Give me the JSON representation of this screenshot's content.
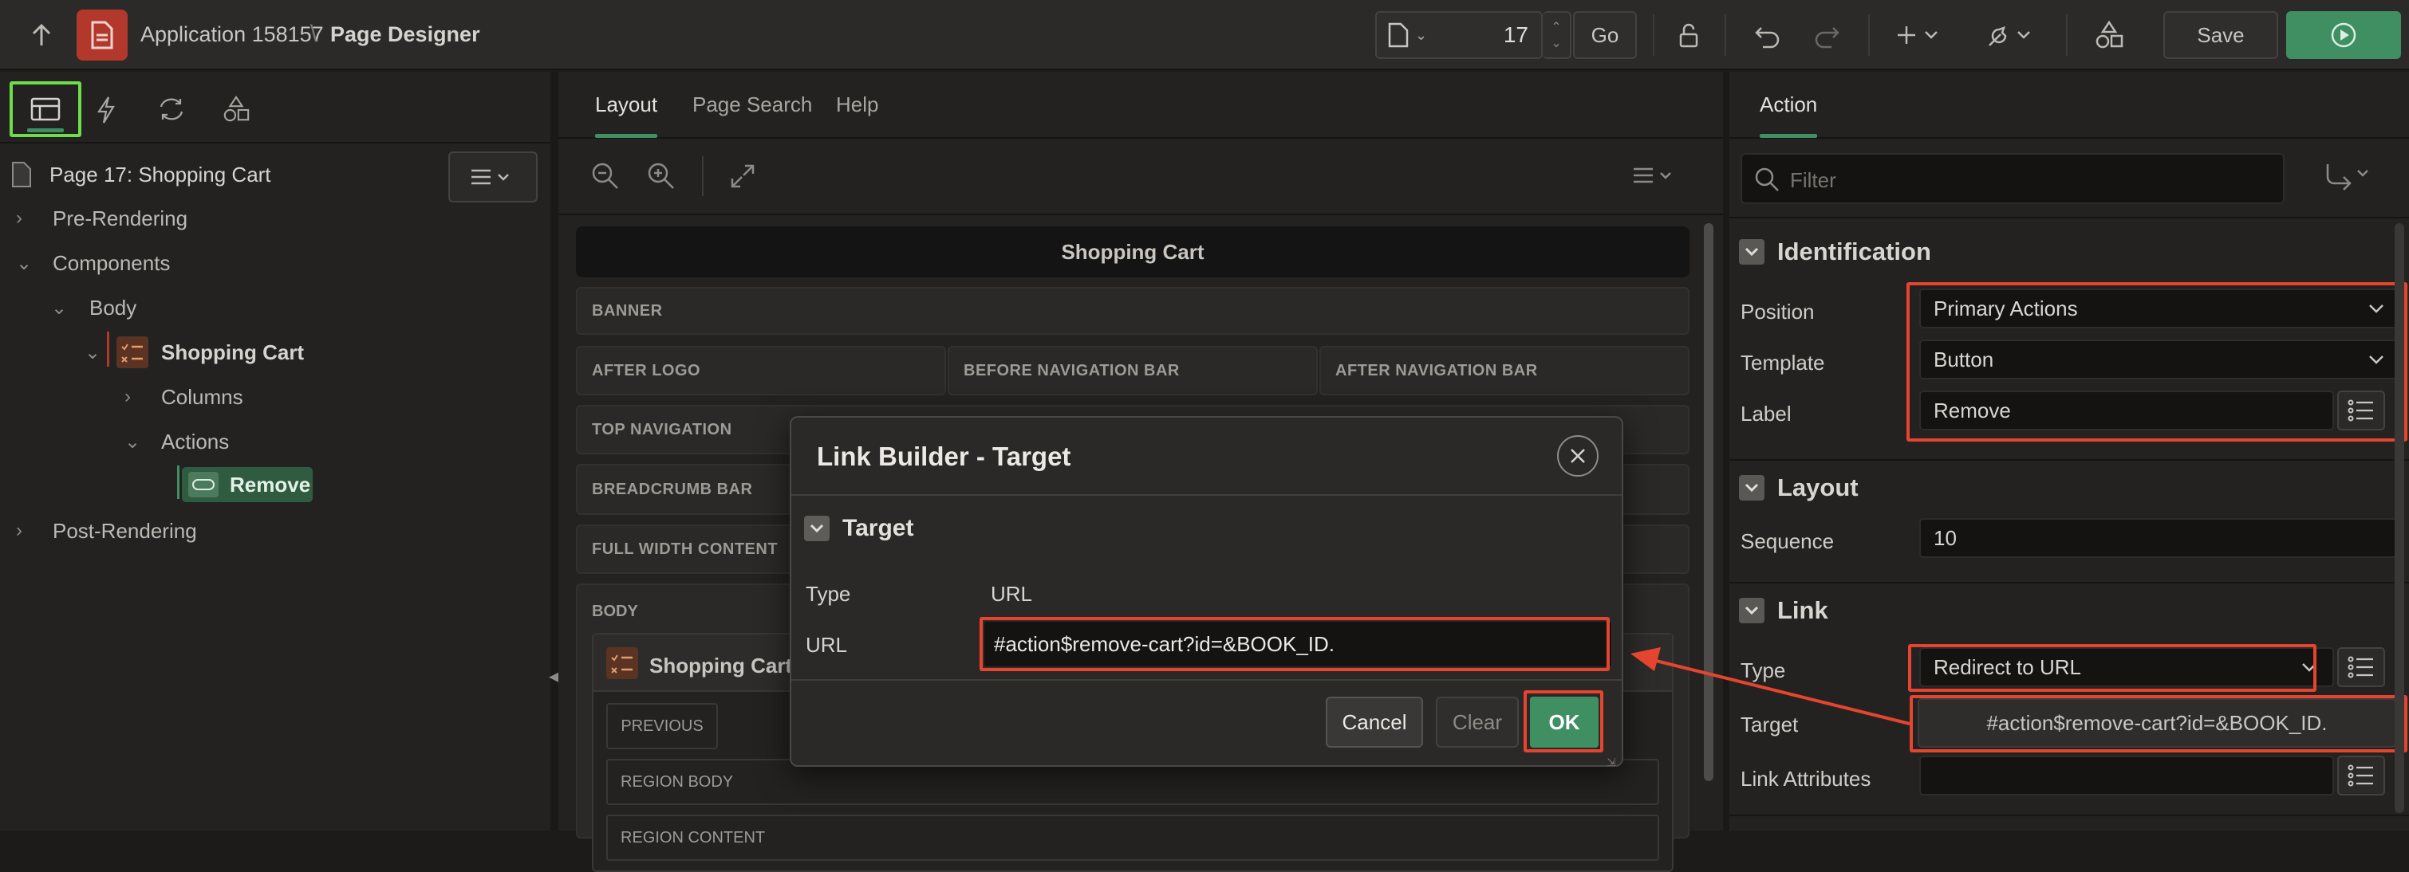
{
  "topbar": {
    "app_name": "Application 158157",
    "separator": "\\",
    "page_designer": "Page Designer",
    "page_number": "17",
    "go_label": "Go",
    "save_label": "Save"
  },
  "left": {
    "page_title": "Page 17: Shopping Cart",
    "tree": [
      {
        "label": "Pre-Rendering"
      },
      {
        "label": "Components"
      },
      {
        "label": "Body"
      },
      {
        "label": "Shopping Cart"
      },
      {
        "label": "Columns"
      },
      {
        "label": "Actions"
      },
      {
        "label": "Remove"
      },
      {
        "label": "Post-Rendering"
      }
    ]
  },
  "center": {
    "tabs": [
      {
        "label": "Layout"
      },
      {
        "label": "Page Search"
      },
      {
        "label": "Help"
      }
    ],
    "page_header": "Shopping Cart",
    "regions": {
      "banner": "BANNER",
      "after_logo": "AFTER LOGO",
      "before_nav": "BEFORE NAVIGATION BAR",
      "after_nav": "AFTER NAVIGATION BAR",
      "top_nav": "TOP NAVIGATION",
      "breadcrumb": "BREADCRUMB BAR",
      "full_width": "FULL WIDTH CONTENT",
      "body": "BODY",
      "sc_region": "Shopping Cart",
      "previous": "PREVIOUS",
      "region_body": "REGION BODY",
      "region_content": "REGION CONTENT"
    }
  },
  "right": {
    "tab": "Action",
    "filter_placeholder": "Filter",
    "sections": {
      "identification": "Identification",
      "layout": "Layout",
      "link": "Link"
    },
    "props": {
      "position_label": "Position",
      "position_value": "Primary Actions",
      "template_label": "Template",
      "template_value": "Button",
      "label_label": "Label",
      "label_value": "Remove",
      "sequence_label": "Sequence",
      "sequence_value": "10",
      "type_label": "Type",
      "type_value": "Redirect to URL",
      "target_label": "Target",
      "target_value": "#action$remove-cart?id=&BOOK_ID.",
      "link_attrs_label": "Link Attributes"
    }
  },
  "dialog": {
    "title": "Link Builder - Target",
    "section": "Target",
    "type_label": "Type",
    "type_value": "URL",
    "url_label": "URL",
    "url_value": "#action$remove-cart?id=&BOOK_ID.",
    "cancel": "Cancel",
    "clear": "Clear",
    "ok": "OK"
  },
  "colors": {
    "accent_green": "#3f8f63",
    "highlight_red": "#e5452f",
    "highlight_lime": "#6fdc4a",
    "app_icon": "#b3382c"
  }
}
